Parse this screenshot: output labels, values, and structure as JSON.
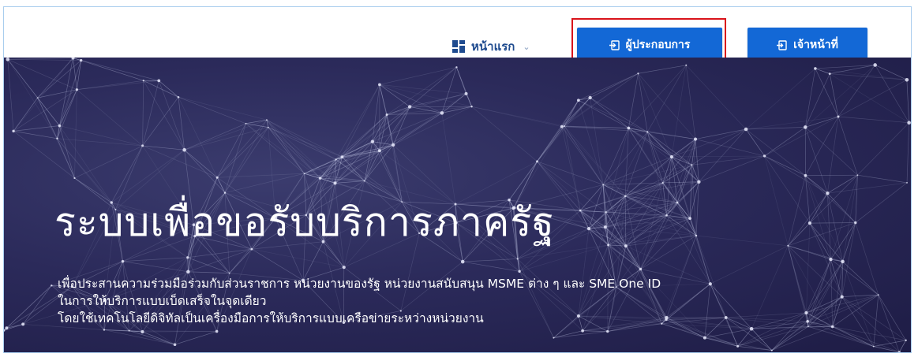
{
  "header": {
    "nav_home": {
      "label": "หน้าแรก",
      "icon": "grid-icon",
      "caret": "⌄"
    },
    "buttons": [
      {
        "label": "ผู้ประกอบการ",
        "icon": "login-icon"
      },
      {
        "label": "เจ้าหน้าที่",
        "icon": "login-icon"
      }
    ]
  },
  "hero": {
    "title": "ระบบเพื่อขอรับบริการภาครัฐ",
    "description_lines": [
      "เพื่อประสานความร่วมมือร่วมกับส่วนราชการ หน่วยงานของรัฐ หน่วยงานสนับสนุน MSME ต่าง ๆ และ SME One ID",
      "ในการให้บริการแบบเบ็ดเสร็จในจุดเดียว",
      "โดยใช้เทคโนโลยีดิจิทัลเป็นเครื่องมือการให้บริการแบบเครือข่ายระหว่างหน่วยงาน"
    ]
  },
  "colors": {
    "primary_button": "#1368d6",
    "nav_text": "#1f4b8f",
    "highlight": "#d9141b",
    "hero_background": "#2b2a5a"
  }
}
